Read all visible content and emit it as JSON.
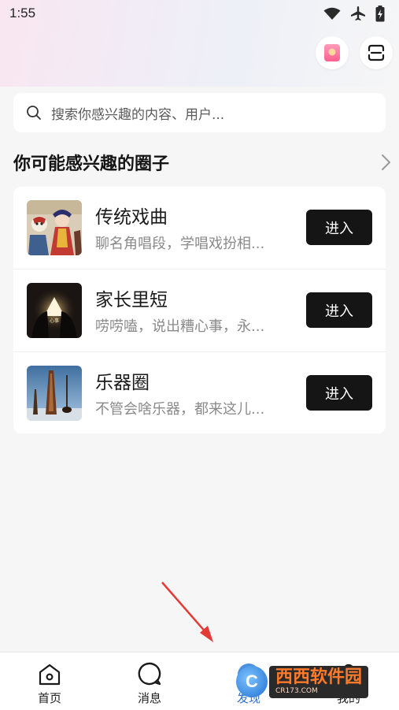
{
  "status_bar": {
    "time": "1:55"
  },
  "search": {
    "placeholder": "搜索你感兴趣的内容、用户..."
  },
  "section": {
    "title": "你可能感兴趣的圈子"
  },
  "circles": [
    {
      "name": "传统戏曲",
      "desc": "聊名角唱段，学唱戏扮相...",
      "button": "进入"
    },
    {
      "name": "家长里短",
      "desc": "唠唠嗑，说出糟心事，永...",
      "button": "进入"
    },
    {
      "name": "乐器圈",
      "desc": "不管会啥乐器，都来这儿...",
      "button": "进入"
    }
  ],
  "bottom_nav": {
    "items": [
      {
        "label": "首页"
      },
      {
        "label": "消息"
      },
      {
        "label": "发现"
      },
      {
        "label": "我的"
      }
    ]
  },
  "watermark": {
    "main": "西西软件园",
    "sub": "CR173.COM"
  },
  "colors": {
    "accent_dark": "#151515",
    "page_bg": "#f6f6f7",
    "arrow_red": "#e53935"
  }
}
